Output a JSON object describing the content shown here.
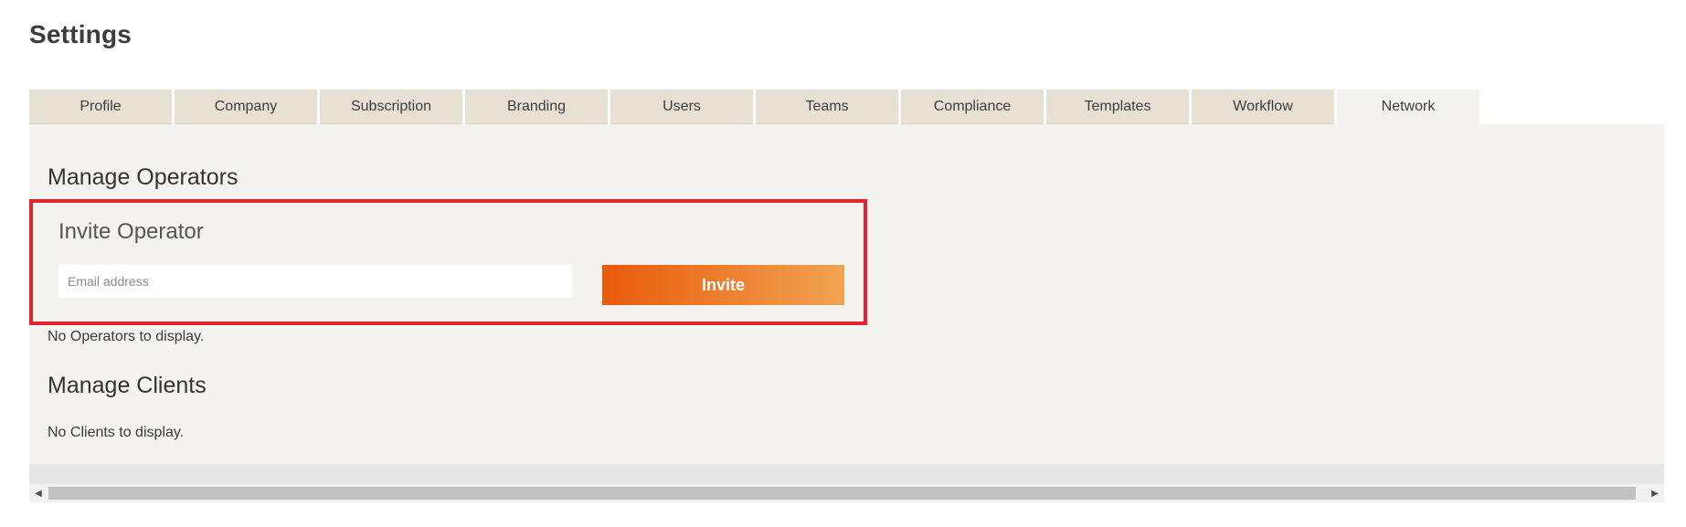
{
  "page": {
    "title": "Settings"
  },
  "tabs": [
    {
      "label": "Profile",
      "active": false
    },
    {
      "label": "Company",
      "active": false
    },
    {
      "label": "Subscription",
      "active": false
    },
    {
      "label": "Branding",
      "active": false
    },
    {
      "label": "Users",
      "active": false
    },
    {
      "label": "Teams",
      "active": false
    },
    {
      "label": "Compliance",
      "active": false
    },
    {
      "label": "Templates",
      "active": false
    },
    {
      "label": "Workflow",
      "active": false
    },
    {
      "label": "Network",
      "active": true
    }
  ],
  "operators": {
    "heading": "Manage Operators",
    "invite": {
      "title": "Invite Operator",
      "email_placeholder": "Email address",
      "email_value": "",
      "button_label": "Invite"
    },
    "empty_message": "No Operators to display."
  },
  "clients": {
    "heading": "Manage Clients",
    "empty_message": "No Clients to display."
  },
  "scrollbar": {
    "left_arrow_icon": "triangle-left-icon",
    "right_arrow_icon": "triangle-right-icon"
  },
  "colors": {
    "highlight_border": "#e0252f",
    "button_gradient_start": "#e95a0c",
    "button_gradient_end": "#f0a452",
    "tab_background": "#e6e1d3",
    "panel_background": "#f5f3ef"
  }
}
